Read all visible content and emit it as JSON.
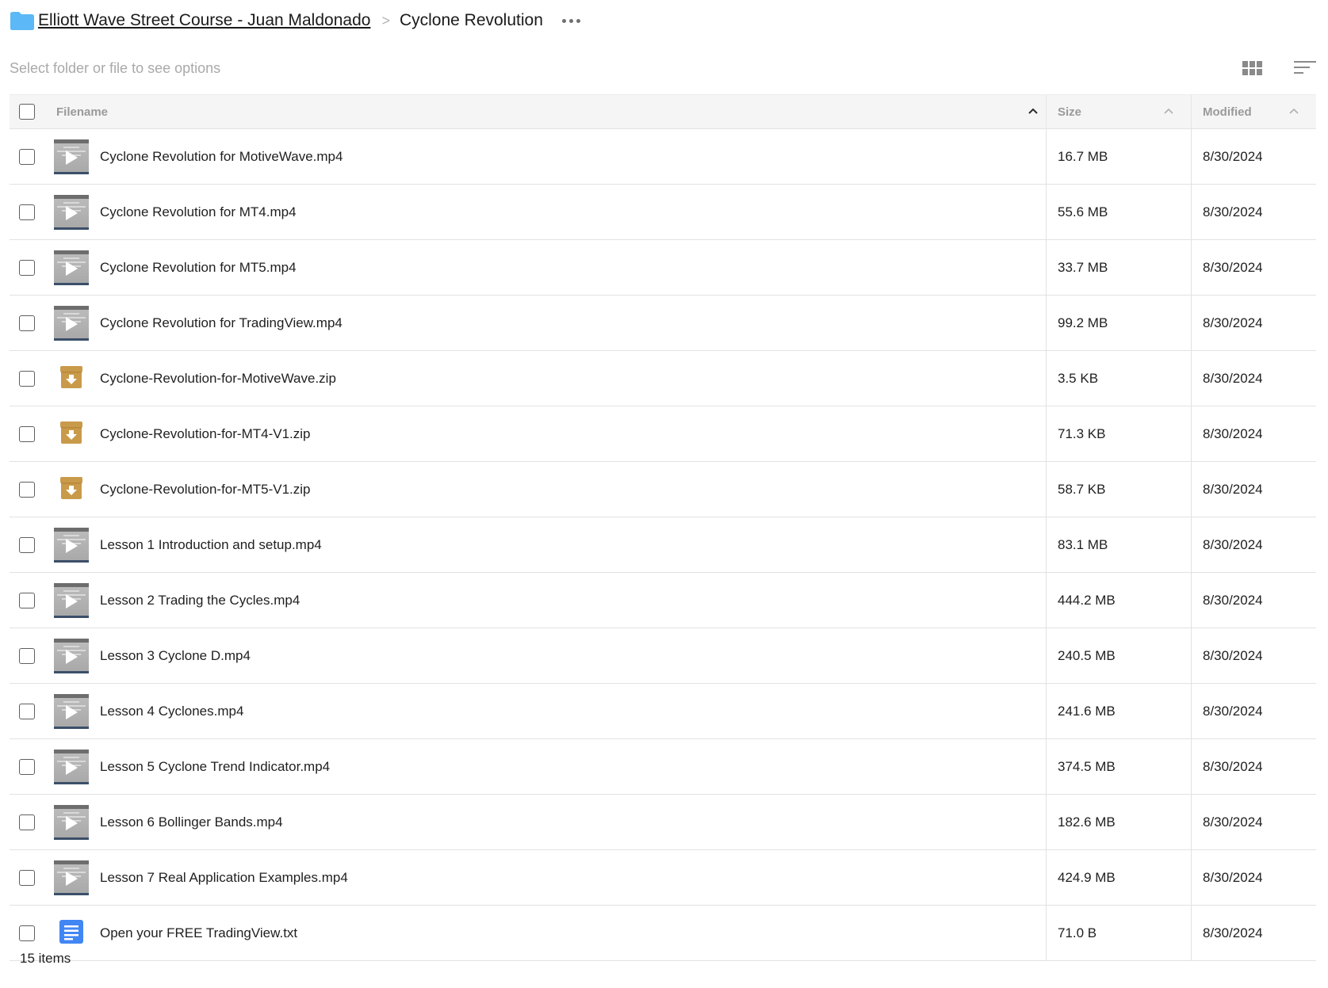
{
  "breadcrumb": {
    "parent": "Elliott Wave Street Course - Juan Maldonado",
    "separator": ">",
    "current": "Cyclone Revolution"
  },
  "toolbar": {
    "hint": "Select folder or file to see options",
    "view_icon": "grid-view-icon",
    "sort_icon": "sort-icon"
  },
  "table": {
    "headers": {
      "name": "Filename",
      "size": "Size",
      "modified": "Modified"
    },
    "rows": [
      {
        "type": "video",
        "name": "Cyclone Revolution for MotiveWave.mp4",
        "size": "16.7 MB",
        "modified": "8/30/2024"
      },
      {
        "type": "video",
        "name": "Cyclone Revolution for MT4.mp4",
        "size": "55.6 MB",
        "modified": "8/30/2024"
      },
      {
        "type": "video",
        "name": "Cyclone Revolution for MT5.mp4",
        "size": "33.7 MB",
        "modified": "8/30/2024"
      },
      {
        "type": "video",
        "name": "Cyclone Revolution for TradingView.mp4",
        "size": "99.2 MB",
        "modified": "8/30/2024"
      },
      {
        "type": "zip",
        "name": "Cyclone-Revolution-for-MotiveWave.zip",
        "size": "3.5 KB",
        "modified": "8/30/2024"
      },
      {
        "type": "zip",
        "name": "Cyclone-Revolution-for-MT4-V1.zip",
        "size": "71.3 KB",
        "modified": "8/30/2024"
      },
      {
        "type": "zip",
        "name": "Cyclone-Revolution-for-MT5-V1.zip",
        "size": "58.7 KB",
        "modified": "8/30/2024"
      },
      {
        "type": "video",
        "name": "Lesson 1 Introduction and setup.mp4",
        "size": "83.1 MB",
        "modified": "8/30/2024"
      },
      {
        "type": "video",
        "name": "Lesson 2 Trading the Cycles.mp4",
        "size": "444.2 MB",
        "modified": "8/30/2024"
      },
      {
        "type": "video",
        "name": "Lesson 3 Cyclone D.mp4",
        "size": "240.5 MB",
        "modified": "8/30/2024"
      },
      {
        "type": "video",
        "name": "Lesson 4 Cyclones.mp4",
        "size": "241.6 MB",
        "modified": "8/30/2024"
      },
      {
        "type": "video",
        "name": "Lesson 5 Cyclone Trend Indicator.mp4",
        "size": "374.5 MB",
        "modified": "8/30/2024"
      },
      {
        "type": "video",
        "name": "Lesson 6 Bollinger Bands.mp4",
        "size": "182.6 MB",
        "modified": "8/30/2024"
      },
      {
        "type": "video",
        "name": "Lesson 7 Real Application Examples.mp4",
        "size": "424.9 MB",
        "modified": "8/30/2024"
      },
      {
        "type": "text",
        "name": "Open your FREE TradingView.txt",
        "size": "71.0 B",
        "modified": "8/30/2024"
      }
    ]
  },
  "footer": {
    "count": "15 items"
  },
  "colors": {
    "folder": "#5cb8f6",
    "zip": "#c99a4a",
    "text_doc": "#4286f4",
    "header_bg": "#f5f5f5"
  }
}
